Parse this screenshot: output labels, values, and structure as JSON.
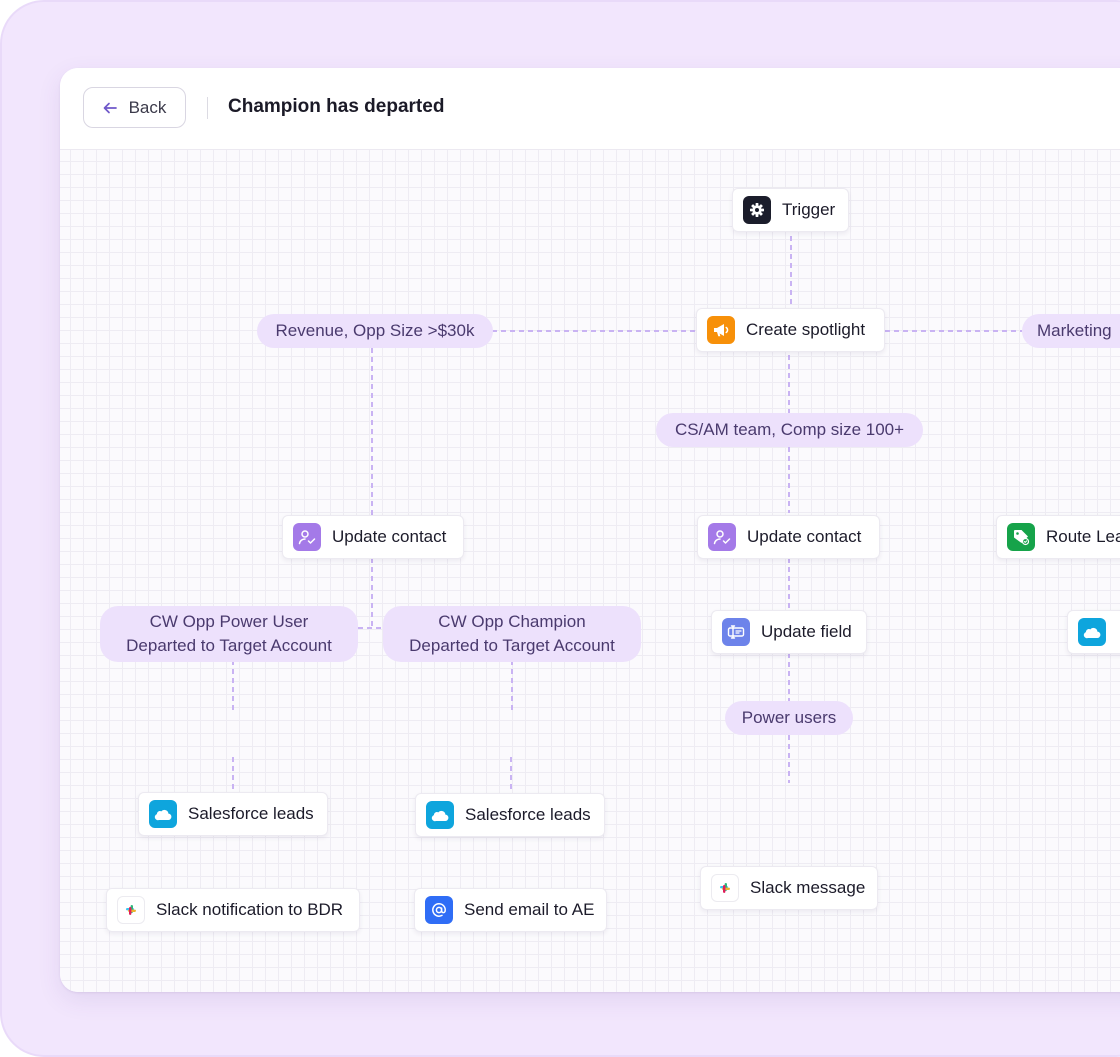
{
  "header": {
    "back_label": "Back",
    "title": "Champion has departed"
  },
  "nodes": {
    "trigger": "Trigger",
    "create_spotlight": "Create spotlight",
    "update_contact_left": "Update contact",
    "update_contact_center": "Update contact",
    "route_leads": "Route Lea",
    "update_field": "Update field",
    "salesforce_leads_1": "Salesforce leads",
    "salesforce_leads_2": "Salesforce leads",
    "slack_notification": "Slack notification to BDR",
    "send_email": "Send email to AE",
    "slack_message": "Slack message"
  },
  "conditions": {
    "revenue": "Revenue, Opp Size >$30k",
    "marketing": "Marketing",
    "cs_am": "CS/AM team, Comp size 100+",
    "power_user_line1": "CW Opp Power User",
    "power_user_line2": "Departed to Target Account",
    "champion_line1": "CW Opp Champion",
    "champion_line2": "Departed to Target Account",
    "power_users": "Power users"
  },
  "colors": {
    "frame_bg": "#f2e6fd",
    "pill_bg": "#ede1fc",
    "connector": "#c9b3f3",
    "trigger_icon_bg": "#1b1d2b",
    "spotlight_icon_bg": "#f79009",
    "contact_icon_bg": "#a47ae8",
    "route_icon_bg": "#16a34a",
    "field_icon_bg": "#6d83ea",
    "salesforce_icon_bg": "#0ea5dd",
    "email_icon_bg": "#2f6df6"
  },
  "icons": {
    "back": "arrow-left-icon",
    "trigger": "gear-icon",
    "spotlight": "megaphone-icon",
    "contact": "user-check-icon",
    "route": "tag-icon",
    "field": "text-field-icon",
    "salesforce": "salesforce-cloud-icon",
    "slack": "slack-icon",
    "email": "at-sign-icon"
  }
}
